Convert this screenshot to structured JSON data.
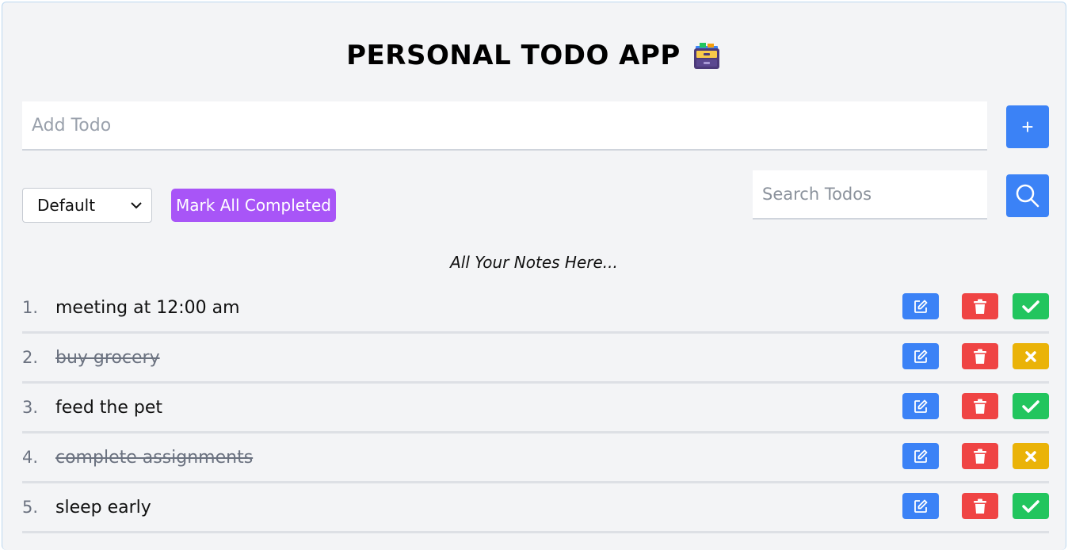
{
  "header": {
    "title": "PERSONAL TODO APP"
  },
  "add": {
    "placeholder": "Add Todo",
    "button_label": "+"
  },
  "filter": {
    "selected": "Default"
  },
  "mark_all_label": "Mark All Completed",
  "search": {
    "placeholder": "Search Todos"
  },
  "notes_heading": "All Your Notes Here...",
  "todos": [
    {
      "number": "1.",
      "text": "meeting at 12:00 am",
      "completed": false
    },
    {
      "number": "2.",
      "text": "buy grocery",
      "completed": true
    },
    {
      "number": "3.",
      "text": "feed the pet",
      "completed": false
    },
    {
      "number": "4.",
      "text": "complete assignments",
      "completed": true
    },
    {
      "number": "5.",
      "text": "sleep early",
      "completed": false
    }
  ],
  "icons": {
    "title": "file-cabinet-icon",
    "search": "search-icon",
    "edit": "edit-icon",
    "delete": "trash-icon",
    "complete": "check-icon",
    "uncomplete": "x-icon"
  },
  "colors": {
    "primary": "#3b82f6",
    "danger": "#ef4444",
    "success": "#22c55e",
    "warning": "#eab308",
    "purple": "#a855f7"
  }
}
